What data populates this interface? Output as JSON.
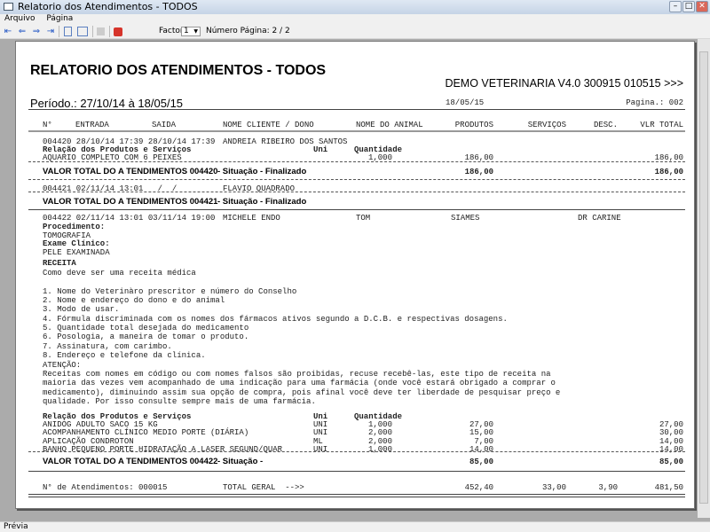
{
  "window": {
    "title": "Relatorio dos Atendimentos - TODOS",
    "min": "–",
    "max": "□",
    "close": "✕"
  },
  "menu": [
    "Arquivo",
    "Página"
  ],
  "toolbar": {
    "first": "⇤",
    "prev": "⇐",
    "next": "⇒",
    "last": "⇥",
    "factor_label": "Factor:",
    "factor_value": "1",
    "page_label": "Número Página: 2 / 2"
  },
  "status": "Prévia",
  "report": {
    "title": "RELATORIO DOS ATENDIMENTOS - TODOS",
    "company": "DEMO VETERINARIA V4.0 300915 010515 >>>",
    "period": "Período.: 27/10/14 à 18/05/15",
    "date": "18/05/15",
    "page": "Pagina.: 002",
    "headers": [
      "N°",
      "ENTRADA",
      "SAIDA",
      "NOME CLIENTE / DONO",
      "NOME DO ANIMAL",
      "PRODUTOS",
      "SERVIÇOS",
      "DESC.",
      "VLR TOTAL"
    ],
    "items_header": {
      "label": "Relação dos Produtos e Serviços",
      "uni": "Uni",
      "qty": "Quantidade"
    },
    "a1": {
      "line": "004420 28/10/14 17:39 28/10/14 17:39",
      "client": "ANDREIA RIBEIRO DOS SANTOS",
      "items": [
        {
          "desc": "AQUARIO COMPLETO COM 6 PEIXES",
          "uni": "",
          "qty": "1,000",
          "unit": "186,00",
          "total": "186,00"
        }
      ],
      "total_label": "VALOR TOTAL DO A TENDIMENTOS 004420",
      "status": "- Situação - Finalizado",
      "prod": "186,00",
      "total": "186,00"
    },
    "a2": {
      "line": "004421 02/11/14 13:01   /  /",
      "client": "FLAVIO QUADRADO",
      "total_label": "VALOR TOTAL DO A TENDIMENTOS 004421",
      "status": "- Situação - Finalizado"
    },
    "a3": {
      "line": "004422 02/11/14 13:01 03/11/14 19:00",
      "client": "MICHELE ENDO",
      "animal": "TOM",
      "breed": "SIAMES",
      "vet": "DR CARINE",
      "notes": [
        "Procedimento:",
        "TOMOGRAFIA",
        "Exame Clínico:",
        "PELE EXAMINADA"
      ],
      "receita": "RECEITA",
      "text": [
        "Como deve ser uma receita médica",
        "",
        "1. Nome do Veterinàro prescritor e número do Conselho",
        "2. Nome e endereço do dono e do animal",
        "3. Modo de usar.",
        "4. Fórmula discriminada com os nomes dos fármacos ativos segundo a D.C.B. e respectivas dosagens.",
        "5. Quantidade total desejada do medicamento",
        "6. Posologia, a maneira de tomar o produto.",
        "7. Assinatura, com carimbo.",
        "8. Endereço e telefone da clínica.",
        "ATENÇÃO:",
        "Receitas com nomes em código ou com nomes falsos são proibidas, recuse recebê-las, este tipo de receita na",
        "maioria das vezes vem acompanhado de uma indicação para uma farmácia (onde você estará obrigado a comprar o",
        "medicamento), diminuindo assim sua opção de compra, pois afinal você deve ter liberdade de pesquisar preço e",
        "qualidade. Por isso consulte sempre mais de uma farmácia."
      ],
      "items": [
        {
          "desc": "ANIDOG ADULTO SACO 15 KG",
          "uni": "UNI",
          "qty": "1,000",
          "unit": "27,00",
          "total": "27,00"
        },
        {
          "desc": "ACOMPANHAMENTO CLÍNICO MEDIO PORTE (DIÁRIA)",
          "uni": "UNI",
          "qty": "2,000",
          "unit": "15,00",
          "total": "30,00"
        },
        {
          "desc": "APLICAÇÃO CONDROTON",
          "uni": "ML",
          "qty": "2,000",
          "unit": "7,00",
          "total": "14,00"
        },
        {
          "desc": "BANHO PEQUENO PORTE HIDRATAÇÃO A LASER SEGUND/QUAR",
          "uni": "UNI",
          "qty": "1,000",
          "unit": "14,00",
          "total": "14,00"
        }
      ],
      "total_label": "VALOR TOTAL DO A TENDIMENTOS 004422",
      "status": "- Situação -",
      "prod": "85,00",
      "total": "85,00"
    },
    "summary": {
      "count": "N° de Atendimentos: 000015",
      "label": "TOTAL GERAL  -->>",
      "prod": "452,40",
      "serv": "33,00",
      "desc": "3,90",
      "total": "481,50"
    }
  }
}
